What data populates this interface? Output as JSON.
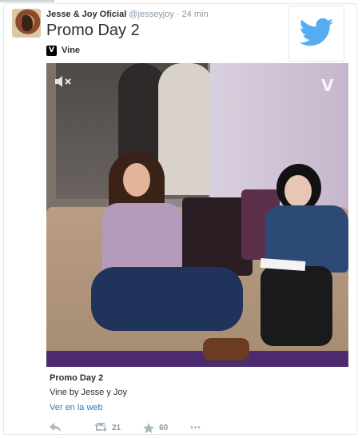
{
  "tweet": {
    "author_name": "Jesse & Joy Oficial",
    "handle": "@jesseyjoy",
    "separator": "·",
    "time": "24 min",
    "text": "Promo Day 2",
    "source_label": "Vine",
    "source_badge": "V"
  },
  "media": {
    "watermark": "V",
    "title": "Promo Day 2",
    "subtitle": "Vine by Jesse y Joy",
    "link": "Ver en la web"
  },
  "actions": {
    "retweet_count": "21",
    "favorite_count": "60",
    "more": "•••"
  },
  "colors": {
    "link": "#2b7bb9",
    "twitter_blue": "#55acee",
    "muted_text": "#8899a6"
  },
  "icons": [
    "twitter-bird-icon",
    "vine-icon",
    "mute-icon",
    "reply-icon",
    "retweet-icon",
    "star-icon",
    "more-icon"
  ]
}
